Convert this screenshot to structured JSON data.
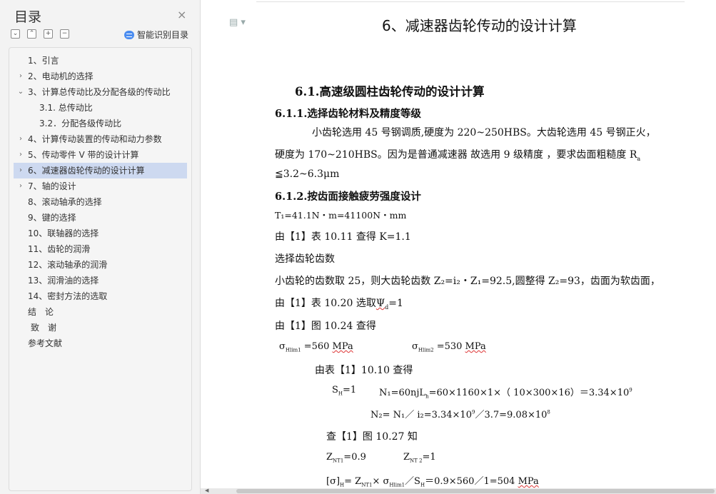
{
  "sidebar": {
    "title": "目录",
    "close_glyph": "×",
    "smart_label": "智能识别目录",
    "tools": [
      "collapse-all",
      "expand-all",
      "add",
      "remove"
    ],
    "items": [
      {
        "label": "1、引言",
        "arrow": ""
      },
      {
        "label": "2、电动机的选择",
        "arrow": "›"
      },
      {
        "label": "3、计算总传动比及分配各级的传动比",
        "arrow": "⌄"
      },
      {
        "label": "3.1. 总传动比",
        "arrow": ""
      },
      {
        "label": "3.2．分配各级传动比",
        "arrow": ""
      },
      {
        "label": "4、计算传动装置的传动和动力参数",
        "arrow": "›"
      },
      {
        "label": "5、传动零件 V 带的设计计算",
        "arrow": "›"
      },
      {
        "label": "6、减速器齿轮传动的设计计算",
        "arrow": "›",
        "selected": true
      },
      {
        "label": "7、轴的设计",
        "arrow": "›"
      },
      {
        "label": "8、滚动轴承的选择",
        "arrow": ""
      },
      {
        "label": "9、键的选择",
        "arrow": ""
      },
      {
        "label": "10、联轴器的选择",
        "arrow": ""
      },
      {
        "label": "11、齿轮的润滑",
        "arrow": ""
      },
      {
        "label": "12、滚动轴承的润滑",
        "arrow": ""
      },
      {
        "label": "13、润滑油的选择",
        "arrow": ""
      },
      {
        "label": "14、密封方法的选取",
        "arrow": ""
      },
      {
        "label": "结　论",
        "arrow": ""
      },
      {
        "label": "致　谢",
        "arrow": ""
      },
      {
        "label": "参考文献",
        "arrow": ""
      }
    ]
  },
  "doc": {
    "title": "6、减速器齿轮传动的设计计算",
    "h_611_main": "6.1.高速级圆柱齿轮传动的设计计算",
    "h_611": "6.1.1.选择齿轮材料及精度等级",
    "para1": "小齿轮选用 45 号钢调质,硬度为 220~250HBS。大齿轮选用 45 号钢正火，",
    "para2": "硬度为 170~210HBS。因为是普通减速器 故选用 9 级精度 ，要求齿面粗糙度 R",
    "para2_sub": "a",
    "para3": "≦3.2~6.3μm",
    "h_612": "6.1.2.按齿面接触疲劳强度设计",
    "t1": "T₁=41.1N・m=41100N・mm",
    "k": "由【1】表 10.11 查得 K=1.1",
    "select_teeth": "选择齿轮齿数",
    "teeth": "小齿轮的齿数取 25，则大齿轮齿数 Z₂=i₂・Z₁=92.5,圆整得 Z₂=93，齿面为软齿面，",
    "psi_pre": "由【1】表 10.20 选取",
    "psi_val": "Ψ",
    "psi_sub": "d",
    "psi_post": "=1",
    "fig1024": "由【1】图 10.24 查得",
    "sigma1_pre": "σ",
    "sigma1_sub": "Hlim1",
    "sigma1_val": " =560 ",
    "sigma1_unit": "MPa",
    "sigma2_pre": "σ",
    "sigma2_sub": "Hlim2",
    "sigma2_val": " =530 ",
    "sigma2_unit": "MPa",
    "table1010": "由表【1】10.10 查得",
    "sh": "S",
    "sh_sub": "H",
    "sh_val": "=1",
    "n1": "N₁=60njL",
    "n1_sub": "h",
    "n1_rest": "=60×1160×1×（ 10×300×16）＝3.34×10",
    "n1_sup": "9",
    "n2_pre": "N₂= N₁／ i₂=3.34×10",
    "n2_sup1": "9",
    "n2_mid": "／3.7=9.08×10",
    "n2_sup2": "8",
    "fig1027": "查【1】图 10.27 知",
    "znt1": "Z",
    "znt1_sub": "NT1",
    "znt1_val": "=0.9",
    "znt2": "Z",
    "znt2_sub": "NT 2",
    "znt2_val": "=1",
    "final_pre": "[σ]",
    "final_sub": "H",
    "final_mid": "= Z",
    "final_sub2": "NT1",
    "final_mid2": "× σ",
    "final_sub3": "Hlim1",
    "final_mid3": "／S",
    "final_sub4": "H",
    "final_rest": "＝0.9×560／1=504 ",
    "final_unit": "MPa"
  }
}
